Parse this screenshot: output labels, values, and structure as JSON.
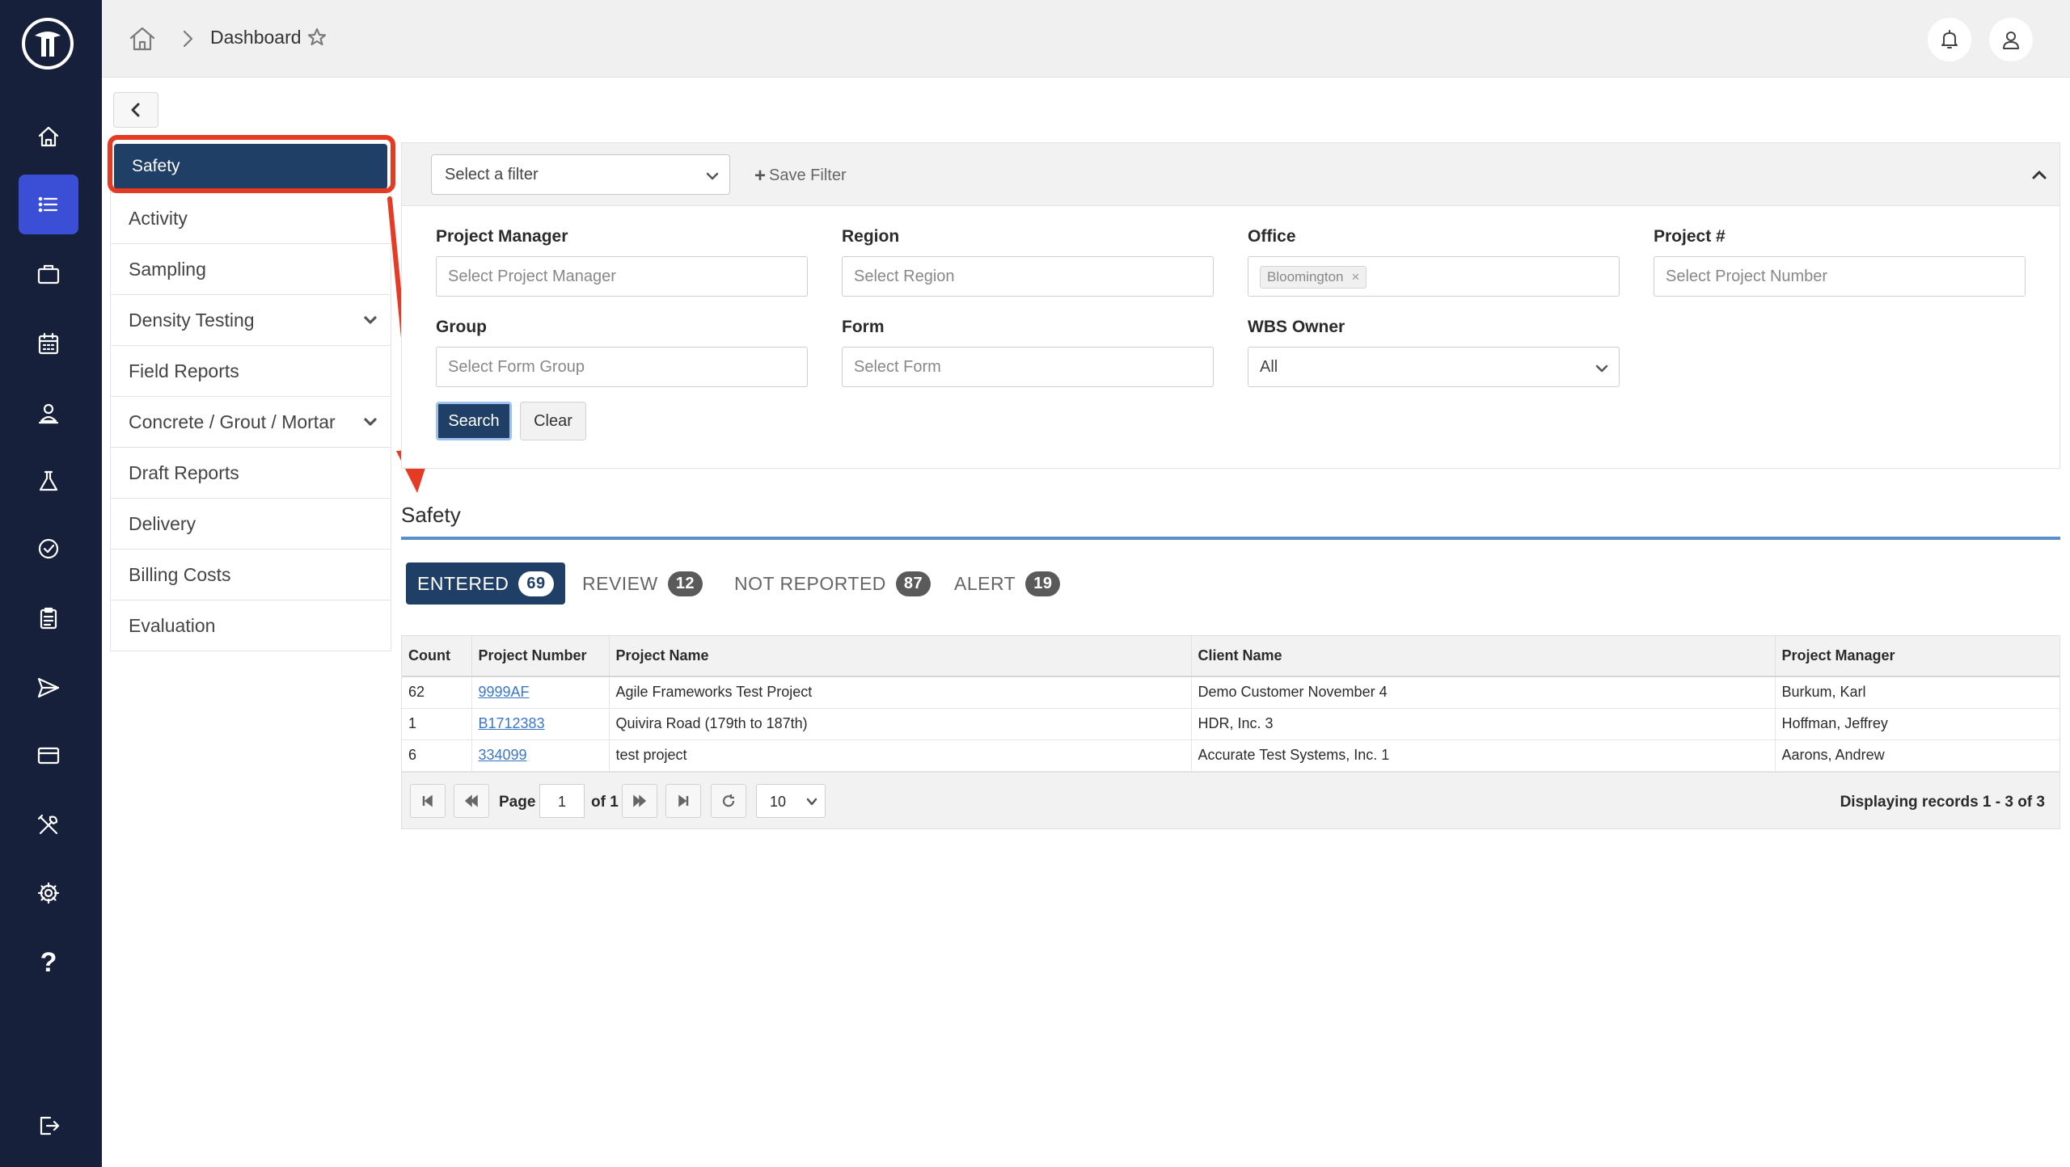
{
  "rail": {
    "items": [
      "home-icon",
      "list-icon",
      "briefcase-icon",
      "calendar-icon",
      "user-icon",
      "flask-icon",
      "badge-check-icon",
      "clipboard-icon",
      "send-icon",
      "credit-card-icon",
      "tools-icon",
      "gear-icon",
      "help-icon",
      "logout-icon"
    ],
    "help_glyph": "?",
    "active_color": "#3b4fd6",
    "background": "#16203a"
  },
  "topbar": {
    "breadcrumb": "Dashboard"
  },
  "menu": {
    "items": [
      {
        "label": "Safety",
        "active": true
      },
      {
        "label": "Activity"
      },
      {
        "label": "Sampling"
      },
      {
        "label": "Density Testing",
        "expandable": true
      },
      {
        "label": "Field Reports"
      },
      {
        "label": "Concrete / Grout / Mortar",
        "expandable": true
      },
      {
        "label": "Draft Reports"
      },
      {
        "label": "Delivery"
      },
      {
        "label": "Billing Costs"
      },
      {
        "label": "Evaluation"
      }
    ]
  },
  "filters": {
    "select_filter_placeholder": "Select a filter",
    "save_filter_label": "Save Filter",
    "project_manager": {
      "label": "Project Manager",
      "placeholder": "Select Project Manager"
    },
    "region": {
      "label": "Region",
      "placeholder": "Select Region"
    },
    "office": {
      "label": "Office",
      "selected": "Bloomington",
      "remove": "×"
    },
    "project_number": {
      "label": "Project #",
      "placeholder": "Select Project Number"
    },
    "group": {
      "label": "Group",
      "placeholder": "Select Form Group"
    },
    "form": {
      "label": "Form",
      "placeholder": "Select Form"
    },
    "wbs_owner": {
      "label": "WBS Owner",
      "value": "All"
    },
    "search_label": "Search",
    "clear_label": "Clear"
  },
  "section": {
    "title": "Safety"
  },
  "tabs": [
    {
      "label": "ENTERED",
      "count": "69",
      "active": true
    },
    {
      "label": "REVIEW",
      "count": "12"
    },
    {
      "label": "NOT REPORTED",
      "count": "87"
    },
    {
      "label": "ALERT",
      "count": "19"
    }
  ],
  "table": {
    "columns": [
      "Count",
      "Project Number",
      "Project Name",
      "Client Name",
      "Project Manager"
    ],
    "rows": [
      [
        "62",
        "9999AF",
        "Agile Frameworks Test Project",
        "Demo Customer November 4",
        "Burkum, Karl"
      ],
      [
        "1",
        "B1712383",
        "Quivira Road (179th to 187th)",
        "HDR, Inc. 3",
        "Hoffman, Jeffrey"
      ],
      [
        "6",
        "334099",
        "test project",
        "Accurate Test Systems, Inc. 1",
        "Aarons, Andrew"
      ]
    ]
  },
  "pager": {
    "page_label": "Page",
    "page_value": "1",
    "of_label": "of 1",
    "page_size": "10",
    "records": "Displaying records 1 - 3 of 3"
  },
  "colors": {
    "primary": "#1f3f66",
    "annotation": "#e53a23",
    "accent_rule": "#5b8fc8",
    "link": "#3a78c8"
  }
}
